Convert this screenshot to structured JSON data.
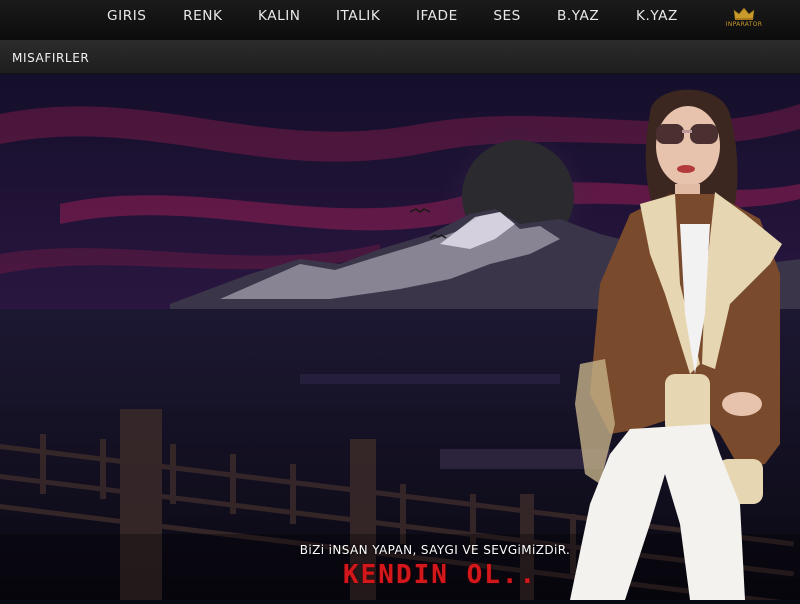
{
  "nav": {
    "items": [
      {
        "label": "GIRIS"
      },
      {
        "label": "RENK"
      },
      {
        "label": "KALIN"
      },
      {
        "label": "ITALIK"
      },
      {
        "label": "IFADE"
      },
      {
        "label": "SES"
      },
      {
        "label": "B.YAZ"
      },
      {
        "label": "K.YAZ"
      }
    ],
    "logo_text": "INPARATOR"
  },
  "room": {
    "title": "MISAFIRLER"
  },
  "banner": {
    "tagline": "BiZi iNSAN YAPAN, SAYGI VE SEVGiMiZDiR.",
    "slogan": "KENDIN OL..",
    "slogan_color": "#d3171a"
  },
  "icons": {
    "logo": "crown-icon"
  }
}
